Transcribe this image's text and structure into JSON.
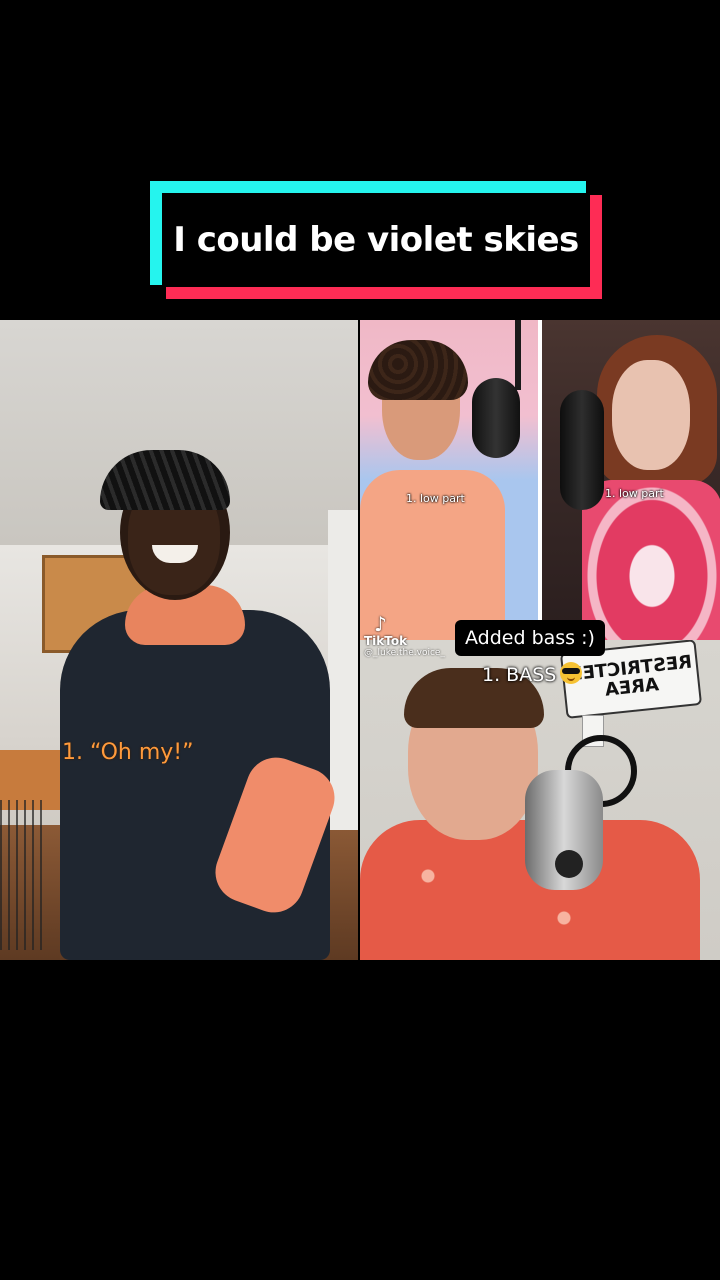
{
  "title": {
    "text": "I could be violet skies",
    "border_colors": {
      "cyan": "#25f4ee",
      "pink": "#fe2c55"
    }
  },
  "tiles": {
    "left": {
      "caption": "1. “Oh my!”",
      "caption_color": "#ff9a3c"
    },
    "mid_top": {
      "caption": "1. low part"
    },
    "right_top": {
      "caption": "1. low part"
    },
    "bottom_right": {
      "sign_text": "RESTRICTED AREA",
      "bubble": "Added bass :)",
      "caption": "1. BASS",
      "emoji": "sunglasses-emoji"
    }
  },
  "watermark": {
    "logo": "tiktok-logo-icon",
    "brand": "TikTok",
    "handle": "@_luke.the.voice_"
  }
}
